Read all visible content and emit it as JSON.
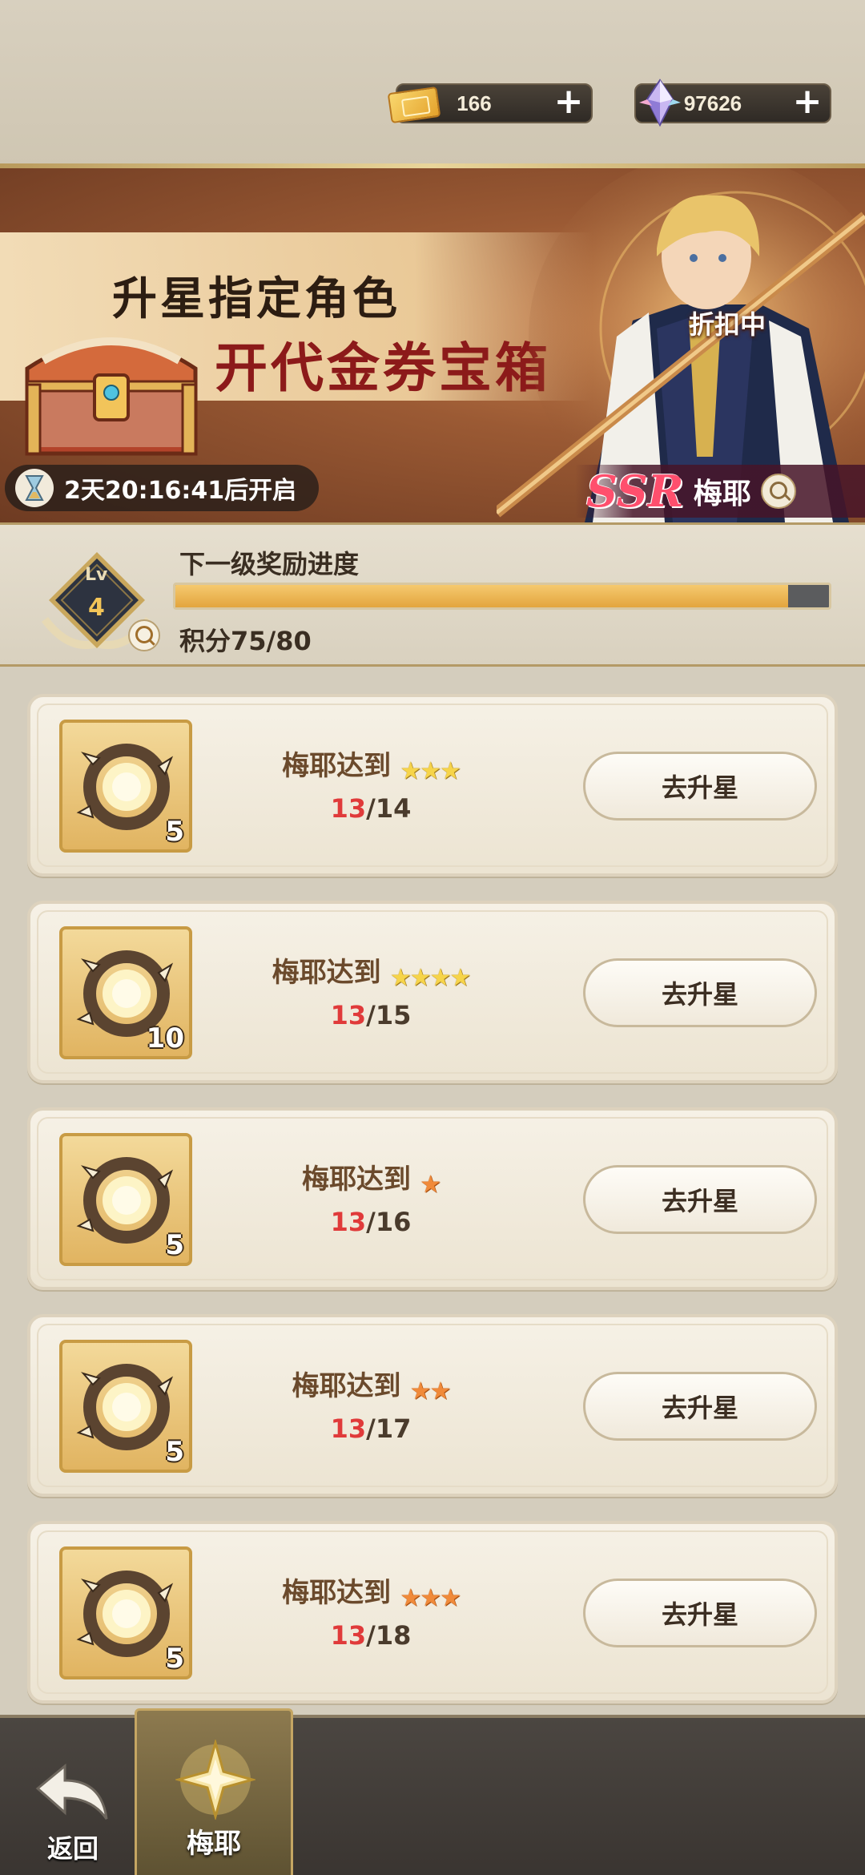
{
  "currency": {
    "tickets": "166",
    "gems": "97626",
    "ticket_icon": "gold-ticket-icon",
    "gem_icon": "crystal-gem-icon",
    "plus_label": "+"
  },
  "banner": {
    "title_line1": "升星指定角色",
    "title_line2": "开代金券宝箱",
    "timer": "2天20:16:41后开启",
    "discount": "折扣中",
    "rarity": "SSR",
    "character_name": "梅耶"
  },
  "level": {
    "lv_label": "Lv",
    "lv_value": "4",
    "title": "下一级奖励进度",
    "score_text": "积分75/80",
    "progress": 0.9375
  },
  "tasks": [
    {
      "count": "5",
      "title": "梅耶达到",
      "star_color": "yellow",
      "stars": "★★★",
      "current": "13",
      "total": "/14",
      "button": "去升星"
    },
    {
      "count": "10",
      "title": "梅耶达到",
      "star_color": "yellow",
      "stars": "★★★★",
      "current": "13",
      "total": "/15",
      "button": "去升星"
    },
    {
      "count": "5",
      "title": "梅耶达到",
      "star_color": "orange",
      "stars": "★",
      "current": "13",
      "total": "/16",
      "button": "去升星"
    },
    {
      "count": "5",
      "title": "梅耶达到",
      "star_color": "orange",
      "stars": "★★",
      "current": "13",
      "total": "/17",
      "button": "去升星"
    },
    {
      "count": "5",
      "title": "梅耶达到",
      "star_color": "orange",
      "stars": "★★★",
      "current": "13",
      "total": "/18",
      "button": "去升星"
    }
  ],
  "bottom": {
    "back_label": "返回",
    "tab_label": "梅耶"
  },
  "colors": {
    "accent_gold": "#e3a53d",
    "progress_current": "#e03a3a",
    "ssr": "#ff4f6d"
  }
}
